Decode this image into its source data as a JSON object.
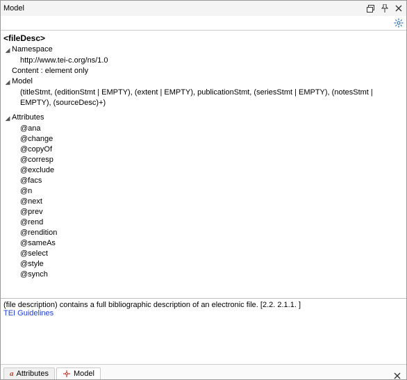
{
  "window": {
    "title": "Model"
  },
  "element": {
    "tag": "<fileDesc>"
  },
  "sections": {
    "namespace": {
      "label": "Namespace",
      "value": "http://www.tei-c.org/ns/1.0"
    },
    "content": {
      "label": "Content : element only"
    },
    "model": {
      "label": "Model",
      "value": "(titleStmt, (editionStmt | EMPTY), (extent | EMPTY), publicationStmt, (seriesStmt | EMPTY), (notesStmt | EMPTY), (sourceDesc)+)"
    },
    "attributes": {
      "label": "Attributes",
      "items": [
        "@ana",
        "@change",
        "@copyOf",
        "@corresp",
        "@exclude",
        "@facs",
        "@n",
        "@next",
        "@prev",
        "@rend",
        "@rendition",
        "@sameAs",
        "@select",
        "@style",
        "@synch"
      ]
    }
  },
  "description": {
    "text": "(file description) contains a full bibliographic description of an electronic file. [2.2. 2.1.1. ]",
    "link": "TEI Guidelines"
  },
  "tabs": {
    "attributes": {
      "label": "Attributes"
    },
    "model": {
      "label": "Model"
    }
  }
}
